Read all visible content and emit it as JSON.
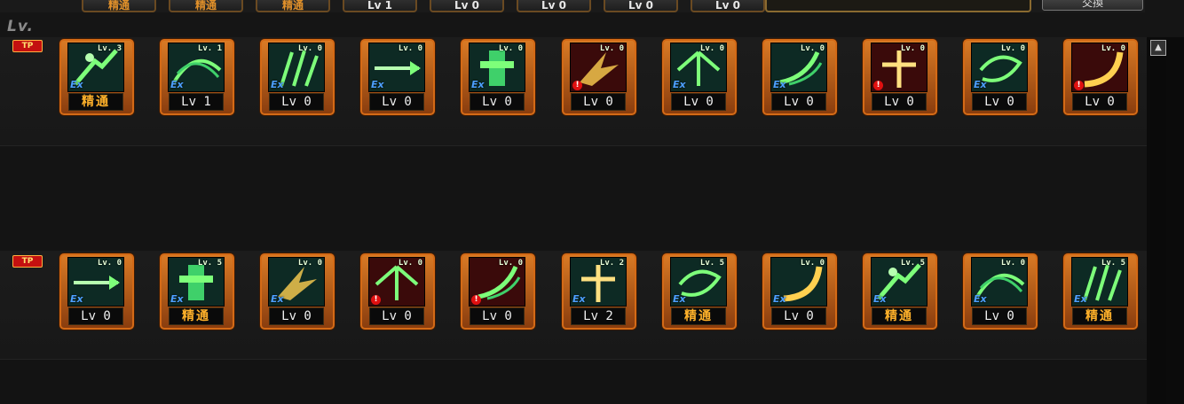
{
  "top_buttons": [
    {
      "label": "精通",
      "style": "orange"
    },
    {
      "label": "精通",
      "style": "orange"
    },
    {
      "label": "精通",
      "style": "orange"
    },
    {
      "label": "Lv 1",
      "style": "white"
    },
    {
      "label": "Lv 0",
      "style": "white"
    },
    {
      "label": "Lv 0",
      "style": "white"
    },
    {
      "label": "Lv 0",
      "style": "white"
    },
    {
      "label": "Lv 0",
      "style": "white"
    }
  ],
  "top_right_button": "交換",
  "lv_header": "Lv.",
  "tp_badge": "TP",
  "scroll_up_glyph": "▲",
  "rows": [
    {
      "skills": [
        {
          "lv_tag": "Lv. 3",
          "label": "精通",
          "mastered": true,
          "badge": "ex",
          "frame": "green",
          "icon": "figure-strike-icon"
        },
        {
          "lv_tag": "Lv. 1",
          "label": "Lv 1",
          "mastered": false,
          "badge": "ex",
          "frame": "green",
          "icon": "claw-slash-icon"
        },
        {
          "lv_tag": "Lv. 0",
          "label": "Lv 0",
          "mastered": false,
          "badge": "ex",
          "frame": "green",
          "icon": "triple-slash-icon"
        },
        {
          "lv_tag": "Lv. 0",
          "label": "Lv 0",
          "mastered": false,
          "badge": "ex",
          "frame": "green",
          "icon": "sword-thrust-icon"
        },
        {
          "lv_tag": "Lv. 0",
          "label": "Lv 0",
          "mastered": false,
          "badge": "ex",
          "frame": "green",
          "icon": "cross-shield-icon"
        },
        {
          "lv_tag": "Lv. 0",
          "label": "Lv 0",
          "mastered": false,
          "badge": "warn",
          "frame": "red",
          "icon": "flame-burst-icon"
        },
        {
          "lv_tag": "Lv. 0",
          "label": "Lv 0",
          "mastered": false,
          "badge": "ex",
          "frame": "green",
          "icon": "winged-blade-icon"
        },
        {
          "lv_tag": "Lv. 0",
          "label": "Lv 0",
          "mastered": false,
          "badge": "ex",
          "frame": "green",
          "icon": "wind-wave-icon"
        },
        {
          "lv_tag": "Lv. 0",
          "label": "Lv 0",
          "mastered": false,
          "badge": "warn",
          "frame": "red",
          "icon": "cross-spark-icon"
        },
        {
          "lv_tag": "Lv. 0",
          "label": "Lv 0",
          "mastered": false,
          "badge": "ex",
          "frame": "green",
          "icon": "spiral-slash-icon"
        },
        {
          "lv_tag": "Lv. 0",
          "label": "Lv 0",
          "mastered": false,
          "badge": "warn",
          "frame": "red",
          "icon": "crescent-icon"
        }
      ]
    },
    {
      "skills": [
        {
          "lv_tag": "Lv. 0",
          "label": "Lv 0",
          "mastered": false,
          "badge": "ex",
          "frame": "green",
          "icon": "burst-spike-icon"
        },
        {
          "lv_tag": "Lv. 5",
          "label": "精通",
          "mastered": true,
          "badge": "ex",
          "frame": "green",
          "icon": "horizontal-slash-icon"
        },
        {
          "lv_tag": "Lv. 0",
          "label": "Lv 0",
          "mastered": false,
          "badge": "ex",
          "frame": "green",
          "icon": "curved-blade-icon"
        },
        {
          "lv_tag": "Lv. 0",
          "label": "Lv 0",
          "mastered": false,
          "badge": "warn",
          "frame": "red",
          "icon": "sword-combo-icon"
        },
        {
          "lv_tag": "Lv. 0",
          "label": "Lv 0",
          "mastered": false,
          "badge": "warn",
          "frame": "red",
          "icon": "cross-guard-icon"
        },
        {
          "lv_tag": "Lv. 2",
          "label": "Lv 2",
          "mastered": false,
          "badge": "ex",
          "frame": "green",
          "icon": "crescent-arc-icon"
        },
        {
          "lv_tag": "Lv. 5",
          "label": "精通",
          "mastered": true,
          "badge": "ex",
          "frame": "green",
          "icon": "beast-head-icon"
        },
        {
          "lv_tag": "Lv. 0",
          "label": "Lv 0",
          "mastered": false,
          "badge": "ex",
          "frame": "green",
          "icon": "gale-strike-icon"
        },
        {
          "lv_tag": "Lv. 5",
          "label": "精通",
          "mastered": true,
          "badge": "ex",
          "frame": "green",
          "icon": "ring-slash-icon"
        },
        {
          "lv_tag": "Lv. 0",
          "label": "Lv 0",
          "mastered": false,
          "badge": "ex",
          "frame": "green",
          "icon": "diagonal-blades-icon"
        },
        {
          "lv_tag": "Lv. 5",
          "label": "精通",
          "mastered": true,
          "badge": "ex",
          "frame": "green",
          "icon": "sweeping-arc-icon"
        }
      ]
    }
  ],
  "colors": {
    "frame_orange": "#d97a25",
    "icon_green": "#7dff7a",
    "icon_red_bg": "#3a0a0a",
    "master_text": "#ffb12a",
    "ex_blue": "#4da0ff",
    "tp_red": "#c41010"
  }
}
